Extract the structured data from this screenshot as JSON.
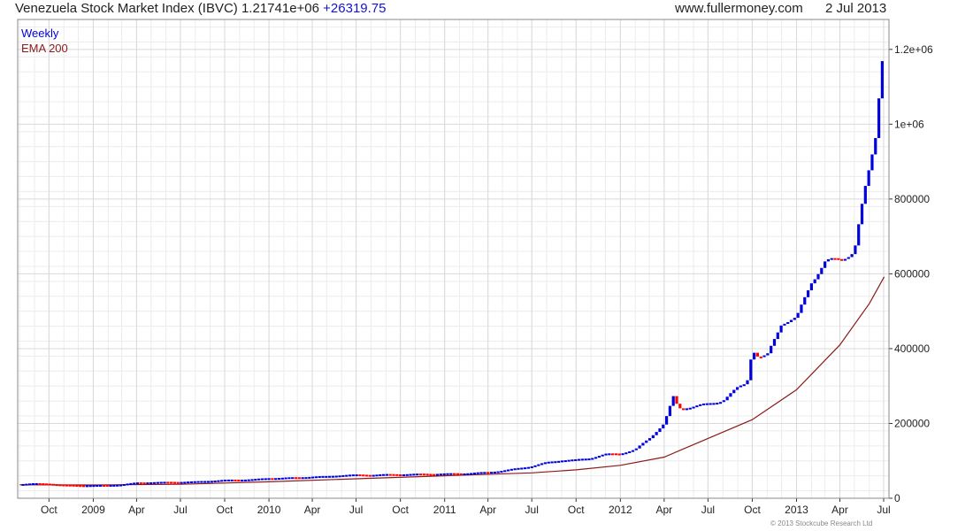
{
  "header": {
    "title": "Venezuela Stock Market Index (IBVC)",
    "last_value": "1.21741e+06",
    "change": "+26319.75",
    "site": "www.fullermoney.com",
    "date": "2 Jul 2013"
  },
  "footer": {
    "copyright": "© 2013 Stockcube Research Ltd"
  },
  "colors": {
    "up": "#0000dd",
    "down": "#ff0000",
    "ema": "#8b1a1a",
    "grid": "#d9d9d9",
    "frame": "#888888"
  },
  "chart_data": {
    "type": "candlestick",
    "grid": true,
    "legend_position": "top-left",
    "ylim": [
      0,
      1280000
    ],
    "xlim": [
      "2008-07-28",
      "2013-07-12"
    ],
    "y_ticks": [
      {
        "value": 0,
        "label": "0"
      },
      {
        "value": 200000,
        "label": "200000"
      },
      {
        "value": 400000,
        "label": "400000"
      },
      {
        "value": 600000,
        "label": "600000"
      },
      {
        "value": 800000,
        "label": "800000"
      },
      {
        "value": 1000000,
        "label": "1e+06"
      },
      {
        "value": 1200000,
        "label": "1.2e+06"
      }
    ],
    "x_ticks": [
      {
        "date": "2008-10-01",
        "label": "Oct"
      },
      {
        "date": "2009-01-01",
        "label": "2009"
      },
      {
        "date": "2009-04-01",
        "label": "Apr"
      },
      {
        "date": "2009-07-01",
        "label": "Jul"
      },
      {
        "date": "2009-10-01",
        "label": "Oct"
      },
      {
        "date": "2010-01-01",
        "label": "2010"
      },
      {
        "date": "2010-04-01",
        "label": "Apr"
      },
      {
        "date": "2010-07-01",
        "label": "Jul"
      },
      {
        "date": "2010-10-01",
        "label": "Oct"
      },
      {
        "date": "2011-01-01",
        "label": "2011"
      },
      {
        "date": "2011-04-01",
        "label": "Apr"
      },
      {
        "date": "2011-07-01",
        "label": "Jul"
      },
      {
        "date": "2011-10-01",
        "label": "Oct"
      },
      {
        "date": "2012-01-01",
        "label": "2012"
      },
      {
        "date": "2012-04-01",
        "label": "Apr"
      },
      {
        "date": "2012-07-01",
        "label": "Jul"
      },
      {
        "date": "2012-10-01",
        "label": "Oct"
      },
      {
        "date": "2013-01-01",
        "label": "2013"
      },
      {
        "date": "2013-04-01",
        "label": "Apr"
      },
      {
        "date": "2013-07-01",
        "label": "Jul"
      }
    ],
    "series": [
      {
        "name": "Weekly",
        "kind": "candlestick",
        "points": [
          [
            "2008-08-01",
            38000
          ],
          [
            "2008-09-01",
            40000
          ],
          [
            "2008-10-01",
            39000
          ],
          [
            "2008-11-01",
            36000
          ],
          [
            "2008-12-01",
            35000
          ],
          [
            "2009-01-01",
            35000
          ],
          [
            "2009-02-01",
            35500
          ],
          [
            "2009-03-01",
            37000
          ],
          [
            "2009-04-01",
            42000
          ],
          [
            "2009-05-01",
            43000
          ],
          [
            "2009-06-01",
            43500
          ],
          [
            "2009-07-01",
            44000
          ],
          [
            "2009-08-01",
            45000
          ],
          [
            "2009-09-01",
            47000
          ],
          [
            "2009-10-01",
            49000
          ],
          [
            "2009-11-01",
            50000
          ],
          [
            "2009-12-01",
            51000
          ],
          [
            "2010-01-01",
            54000
          ],
          [
            "2010-02-01",
            55000
          ],
          [
            "2010-03-01",
            56000
          ],
          [
            "2010-04-01",
            58000
          ],
          [
            "2010-05-01",
            59000
          ],
          [
            "2010-06-01",
            62000
          ],
          [
            "2010-07-01",
            63000
          ],
          [
            "2010-08-01",
            63000
          ],
          [
            "2010-09-01",
            64000
          ],
          [
            "2010-10-01",
            64500
          ],
          [
            "2010-11-01",
            65000
          ],
          [
            "2010-12-01",
            65500
          ],
          [
            "2011-01-01",
            66000
          ],
          [
            "2011-02-01",
            66500
          ],
          [
            "2011-03-01",
            68000
          ],
          [
            "2011-04-01",
            70000
          ],
          [
            "2011-05-01",
            74000
          ],
          [
            "2011-06-01",
            80000
          ],
          [
            "2011-07-01",
            86000
          ],
          [
            "2011-08-01",
            96000
          ],
          [
            "2011-09-01",
            102000
          ],
          [
            "2011-10-01",
            103000
          ],
          [
            "2011-11-01",
            108000
          ],
          [
            "2011-12-01",
            118000
          ],
          [
            "2012-01-01",
            120000
          ],
          [
            "2012-02-01",
            130000
          ],
          [
            "2012-03-01",
            160000
          ],
          [
            "2012-04-01",
            200000
          ],
          [
            "2012-04-20",
            270000
          ],
          [
            "2012-05-01",
            240000
          ],
          [
            "2012-06-01",
            246000
          ],
          [
            "2012-07-01",
            252000
          ],
          [
            "2012-08-01",
            262000
          ],
          [
            "2012-09-01",
            295000
          ],
          [
            "2012-09-20",
            310000
          ],
          [
            "2012-10-01",
            400000
          ],
          [
            "2012-10-15",
            375000
          ],
          [
            "2012-11-01",
            380000
          ],
          [
            "2012-12-01",
            470000
          ],
          [
            "2013-01-01",
            480000
          ],
          [
            "2013-02-01",
            580000
          ],
          [
            "2013-03-01",
            630000
          ],
          [
            "2013-04-01",
            640000
          ],
          [
            "2013-05-01",
            660000
          ],
          [
            "2013-05-20",
            800000
          ],
          [
            "2013-06-01",
            880000
          ],
          [
            "2013-06-15",
            980000
          ],
          [
            "2013-06-25",
            1150000
          ],
          [
            "2013-07-02",
            1217410
          ]
        ]
      },
      {
        "name": "EMA 200",
        "kind": "line",
        "points": [
          [
            "2008-08-01",
            36000
          ],
          [
            "2009-01-01",
            35500
          ],
          [
            "2009-07-01",
            37500
          ],
          [
            "2010-01-01",
            44000
          ],
          [
            "2010-07-01",
            52000
          ],
          [
            "2011-01-01",
            60000
          ],
          [
            "2011-07-01",
            68000
          ],
          [
            "2011-10-01",
            76000
          ],
          [
            "2012-01-01",
            88000
          ],
          [
            "2012-04-01",
            110000
          ],
          [
            "2012-07-01",
            160000
          ],
          [
            "2012-10-01",
            210000
          ],
          [
            "2013-01-01",
            290000
          ],
          [
            "2013-04-01",
            410000
          ],
          [
            "2013-06-01",
            520000
          ],
          [
            "2013-07-02",
            592000
          ]
        ]
      }
    ]
  }
}
